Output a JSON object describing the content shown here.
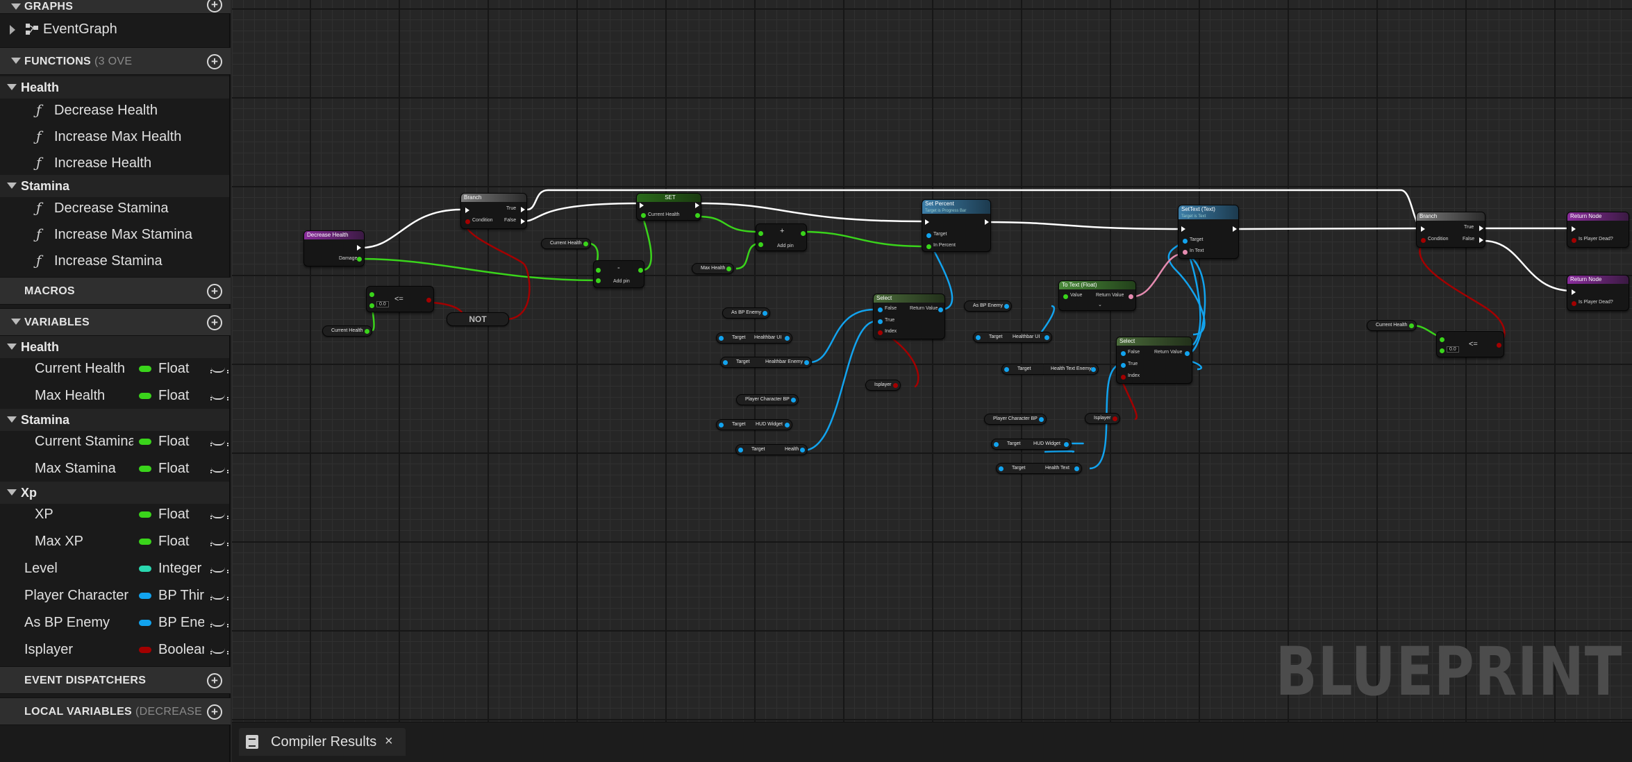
{
  "sidebar": {
    "graphs": {
      "header": "GRAPHS",
      "items": [
        {
          "label": "EventGraph"
        }
      ]
    },
    "functions": {
      "header": "FUNCTIONS",
      "header_sub": "(3 OVE",
      "categories": [
        {
          "label": "Health",
          "items": [
            "Decrease Health",
            "Increase Max Health",
            "Increase Health"
          ]
        },
        {
          "label": "Stamina",
          "items": [
            "Decrease Stamina",
            "Increase Max Stamina",
            "Increase Stamina"
          ]
        }
      ]
    },
    "macros": {
      "header": "MACROS"
    },
    "variables": {
      "header": "VARIABLES",
      "categories": [
        {
          "label": "Health",
          "items": [
            {
              "name": "Current Health",
              "type": "Float",
              "color": "#3ad41b"
            },
            {
              "name": "Max Health",
              "type": "Float",
              "color": "#3ad41b"
            }
          ]
        },
        {
          "label": "Stamina",
          "items": [
            {
              "name": "Current Stamina",
              "type": "Float",
              "color": "#3ad41b"
            },
            {
              "name": "Max Stamina",
              "type": "Float",
              "color": "#3ad41b"
            }
          ]
        },
        {
          "label": "Xp",
          "items": [
            {
              "name": "XP",
              "type": "Float",
              "color": "#3ad41b"
            },
            {
              "name": "Max XP",
              "type": "Float",
              "color": "#3ad41b"
            }
          ]
        }
      ],
      "uncategorized": [
        {
          "name": "Level",
          "type": "Integer",
          "color": "#2ad8b0"
        },
        {
          "name": "Player Character",
          "type": "BP Third",
          "color": "#12a3ee"
        },
        {
          "name": "As BP Enemy",
          "type": "BP Enemy",
          "color": "#12a3ee"
        },
        {
          "name": "Isplayer",
          "type": "Boolean",
          "color": "#a30000"
        }
      ]
    },
    "event_dispatchers": {
      "header": "EVENT DISPATCHERS"
    },
    "local_variables": {
      "header": "LOCAL VARIABLES",
      "header_sub": "(DECREASE HEA"
    }
  },
  "graph": {
    "watermark": "BLUEPRINT",
    "nodes": {
      "decrease_health": {
        "title": "Decrease Health",
        "pin_damage": "Damage"
      },
      "branch1": {
        "title": "Branch",
        "pin_condition": "Condition",
        "pin_true": "True",
        "pin_false": "False"
      },
      "set": {
        "title": "SET",
        "pin_value": "Current Health"
      },
      "subtract": {
        "symbol": "-",
        "add_pin": "Add pin"
      },
      "add": {
        "symbol": "+",
        "add_pin": "Add pin"
      },
      "set_percent": {
        "title": "Set Percent",
        "subtitle": "Target is Progress Bar",
        "pin_target": "Target",
        "pin_in": "In Percent"
      },
      "select1": {
        "title": "Select",
        "pin_false": "False",
        "pin_true": "True",
        "pin_index": "Index",
        "pin_return": "Return Value"
      },
      "settext": {
        "title": "SetText (Text)",
        "subtitle": "Target is Text",
        "pin_target": "Target",
        "pin_in": "In Text"
      },
      "totext": {
        "title": "To Text (Float)",
        "pin_value": "Value",
        "pin_return": "Return Value"
      },
      "select2": {
        "title": "Select",
        "pin_false": "False",
        "pin_true": "True",
        "pin_index": "Index",
        "pin_return": "Return Value"
      },
      "branch2": {
        "title": "Branch",
        "pin_condition": "Condition",
        "pin_true": "True",
        "pin_false": "False"
      },
      "return1": {
        "title": "Return Node",
        "pin": "Is Player Dead?"
      },
      "return2": {
        "title": "Return Node",
        "pin": "Is Player Dead?"
      },
      "lte1": {
        "symbol": "<=",
        "value": "0.0"
      },
      "lte2": {
        "symbol": "<=",
        "value": "0.0"
      },
      "not": {
        "label": "NOT"
      }
    },
    "vars": {
      "current_health_1": "Current Health",
      "current_health_2": "Current Health",
      "current_health_3": "Current Health",
      "max_health": "Max Health",
      "as_bp_enemy_1": "As BP Enemy",
      "as_bp_enemy_2": "As BP Enemy",
      "target_label": "Target",
      "healthbar_ui": "Healthbar UI",
      "healthbar_enemy": "Healthbar Enemy",
      "player_character_1": "Player Character BP",
      "player_character_2": "Player Character BP",
      "hud_widget": "HUD Widget",
      "health": "Health",
      "health_text_enemy": "Health Text Enemy",
      "health_text": "Health Text",
      "isplayer_1": "Isplayer",
      "isplayer_2": "Isplayer"
    }
  },
  "bottom": {
    "tab_label": "Compiler Results",
    "close": "×"
  },
  "colors": {
    "float": "#3ad41b",
    "object": "#12a3ee",
    "bool": "#a30000",
    "text": "#e58bb0",
    "exec": "#ffffff"
  }
}
